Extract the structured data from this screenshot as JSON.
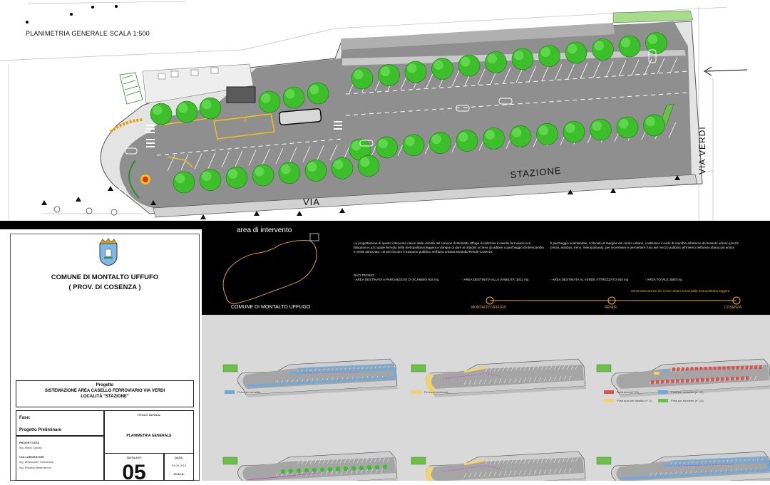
{
  "plan": {
    "title": "PLANIMETRIA GENERALE SCALA 1:500",
    "street_via": "VIA",
    "street_stazione": "STAZIONE",
    "street_via_verdi": "VIA VERDI",
    "bus_label": "BUS"
  },
  "inset": {
    "label_top": "area di intervento",
    "label_bottom": "COMUNE DI MONTALTO UFFUGO"
  },
  "description": {
    "col1": "La progettazione di questo intervento nasce dalla volontà del comune di Montalto Uffugo di utilizzare il casello ferroviario Acri-Bisignano-Luzzi quale fermata della metropolitana leggera e dunque di dare ai cittadini un'area da adibire a parcheggio d'interscambio e verde attrezzato, ciò per favorire il trasporto pubblico nell'area urbana Montalto-Rende-Cosenza",
    "col2": "Il parcheggio scambiatore, collocato al margine del centro urbano, costituisce il nodo di scambio all'interno del tessuto urbano (mezzi privati, autobus, treno, metropolitana), per incentivare e permettere l'uso del mezzo pubblico all'interno dell'area urbana più antica",
    "dati_title": "DATI TECNICI",
    "dati_1": "- AREA DESTINATA A PARCHEGGIO DI SCAMBIO 934 mq",
    "dati_2": "- AREA DESTINATA ALLA VIABILITA' 1611 mq",
    "dati_3": "- AREA DESTINATA AL VERDE ATTREZZATO 934 mq",
    "dati_4": "- AREA TOTALE 3500 mq",
    "schema_title": "Schematizzazione dei centri urbani serviti dalla metropolitana leggera",
    "stop_1": "MONTALTO UFFUGO",
    "stop_2": "RENDE",
    "stop_3": "COSENZA"
  },
  "legend": {
    "l1": "Percorso carrabile",
    "l2": "Percorso pedonale",
    "l3": "Posti auto (n° 70)",
    "l4": "Posti per motocicli (n° 12)",
    "l5": "Posti auto per disabili (n° 3)",
    "l6": "Posti per biciclette (n° 10)"
  },
  "titleblock": {
    "comune": "COMUNE DI  MONTALTO UFFUFO",
    "provincia": "( PROV. DI COSENZA )",
    "progetto_label": "Progetto",
    "progetto_1": "SISTEMAZIONE AREA CASELLO FERROVIARIO VIA VERDI",
    "progetto_2": "LOCALITÀ \"STAZIONE\"",
    "fase_label": "Fase:",
    "fase_value": "Progetto Preliminare",
    "progettista_label": "PROGETTISTA",
    "progettista_name": "Ing. Mario Caruso",
    "collab_label": "COLLABORATORI",
    "collab_1": "Ing. Alessandro Cerminara",
    "collab_2": "Ing. Rosaria Mastrobuoni",
    "titolo_label": "TITOLO TAVOLA:",
    "titolo_value": "PLANIMETRIA GENERALE",
    "tavola_label": "TAVOLA N°",
    "tavola_value": "05",
    "data_label": "DATA:",
    "data_value": "04-09-2012",
    "scala_label": "SCALA:"
  },
  "colors": {
    "tree": "#3cbf2a",
    "road": "#9a9a9a",
    "asphalt": "#8c8c8c",
    "marking": "#f2c315",
    "gold": "#f0b030",
    "blue": "#6fa8dc",
    "red": "#d9534f",
    "green_strip": "#6cc04a"
  }
}
